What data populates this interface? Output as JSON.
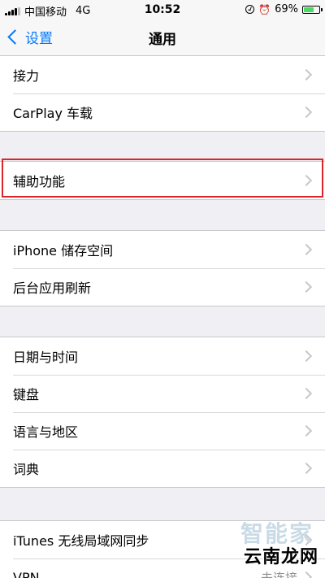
{
  "status_bar": {
    "carrier": "中国移动",
    "network": "4G",
    "time": "10:52",
    "battery_percent": "69%",
    "battery_level": 0.69,
    "battery_color": "#4cd964",
    "icons": [
      "signal-bars-icon",
      "orientation-lock-icon",
      "alarm-icon",
      "battery-icon"
    ]
  },
  "nav": {
    "back_label": "设置",
    "title": "通用"
  },
  "groups": [
    {
      "items": [
        {
          "label": "接力"
        },
        {
          "label": "CarPlay 车载"
        }
      ]
    },
    {
      "items": [
        {
          "label": "辅助功能",
          "highlighted": true
        }
      ]
    },
    {
      "items": [
        {
          "label": "iPhone 储存空间"
        },
        {
          "label": "后台应用刷新"
        }
      ]
    },
    {
      "items": [
        {
          "label": "日期与时间"
        },
        {
          "label": "键盘"
        },
        {
          "label": "语言与地区"
        },
        {
          "label": "词典"
        }
      ]
    },
    {
      "items": [
        {
          "label": "iTunes 无线局域网同步"
        },
        {
          "label": "VPN",
          "value": "未连接"
        }
      ]
    }
  ],
  "watermark": {
    "line1": "智能家",
    "line2": "云南龙网"
  },
  "colors": {
    "accent": "#007aff",
    "highlight_border": "#d8262a",
    "background": "#efeff4"
  }
}
